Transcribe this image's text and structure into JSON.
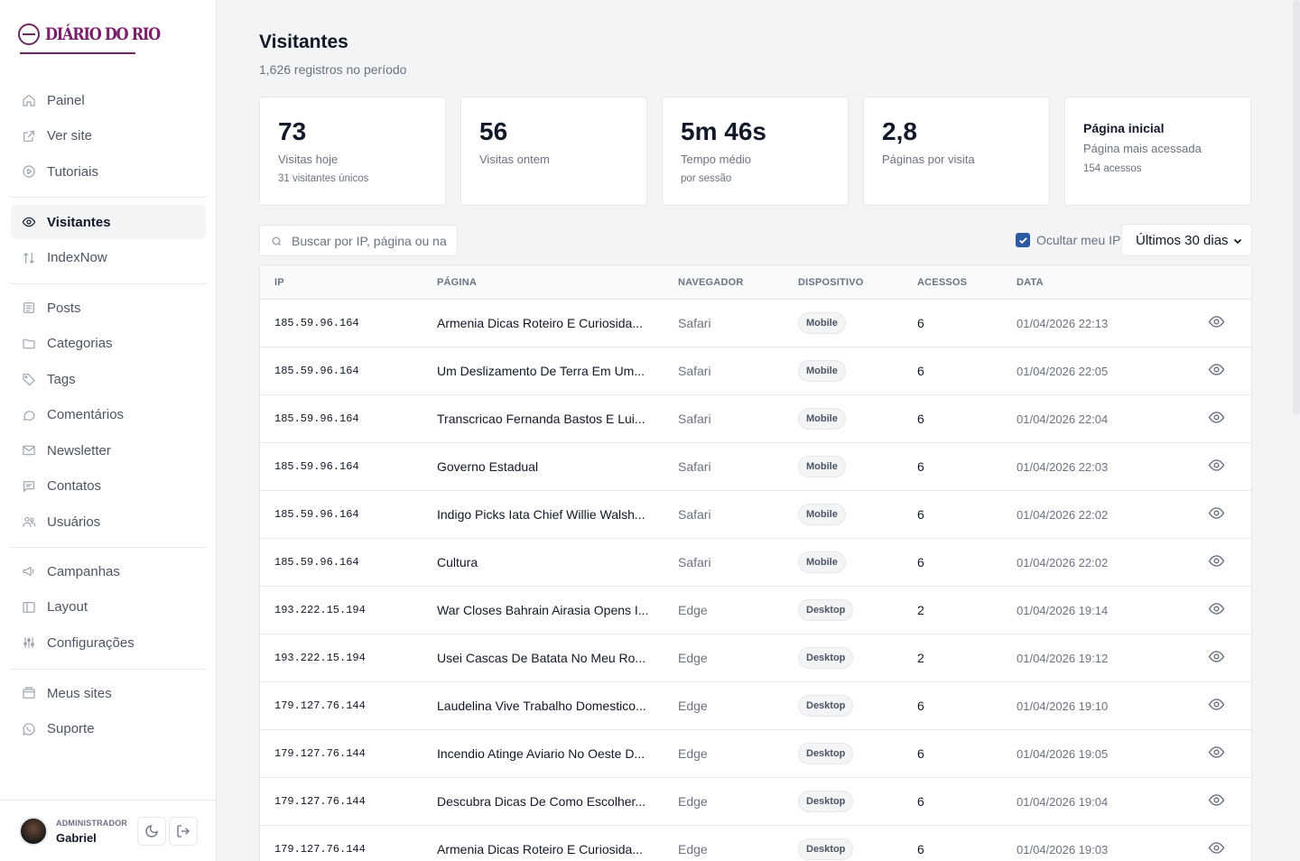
{
  "brand": {
    "name": "DIÁRIO DO RIO"
  },
  "sidebar": {
    "groups": [
      [
        {
          "label": "Painel",
          "icon": "home-icon"
        },
        {
          "label": "Ver site",
          "icon": "external-link-icon"
        },
        {
          "label": "Tutoriais",
          "icon": "play-circle-icon"
        }
      ],
      [
        {
          "label": "Visitantes",
          "icon": "eye-icon",
          "active": true
        },
        {
          "label": "IndexNow",
          "icon": "arrows-updown-icon"
        }
      ],
      [
        {
          "label": "Posts",
          "icon": "document-icon"
        },
        {
          "label": "Categorias",
          "icon": "folder-icon"
        },
        {
          "label": "Tags",
          "icon": "tag-icon"
        },
        {
          "label": "Comentários",
          "icon": "comment-icon"
        },
        {
          "label": "Newsletter",
          "icon": "mail-icon"
        },
        {
          "label": "Contatos",
          "icon": "chat-icon"
        },
        {
          "label": "Usuários",
          "icon": "users-icon"
        }
      ],
      [
        {
          "label": "Campanhas",
          "icon": "megaphone-icon"
        },
        {
          "label": "Layout",
          "icon": "layout-icon"
        },
        {
          "label": "Configurações",
          "icon": "sliders-icon"
        }
      ],
      [
        {
          "label": "Meus sites",
          "icon": "sites-icon"
        },
        {
          "label": "Suporte",
          "icon": "whatsapp-icon"
        }
      ]
    ],
    "user": {
      "role": "ADMINISTRADOR",
      "name": "Gabriel"
    }
  },
  "header": {
    "title": "Visitantes",
    "subtitle": "1,626 registros no período"
  },
  "stats": [
    {
      "value": "73",
      "label": "Visitas hoje",
      "sub": "31 visitantes únicos"
    },
    {
      "value": "56",
      "label": "Visitas ontem",
      "sub": ""
    },
    {
      "value": "5m 46s",
      "label": "Tempo médio",
      "sub": "por sessão"
    },
    {
      "value": "2,8",
      "label": "Páginas por visita",
      "sub": ""
    },
    {
      "value": "Página inicial",
      "label": "Página mais acessada",
      "sub": "154 acessos"
    }
  ],
  "filters": {
    "search_placeholder": "Buscar por IP, página ou na",
    "hide_ip_label": "Ocultar meu IP",
    "hide_ip_checked": true,
    "range_selected": "Últimos 30 dias"
  },
  "table": {
    "columns": [
      "IP",
      "PÁGINA",
      "NAVEGADOR",
      "DISPOSITIVO",
      "ACESSOS",
      "DATA"
    ],
    "rows": [
      {
        "ip": "185.59.96.164",
        "page": "Armenia Dicas Roteiro E Curiosida...",
        "browser": "Safari",
        "device": "Mobile",
        "accesses": "6",
        "date": "01/04/2026 22:13"
      },
      {
        "ip": "185.59.96.164",
        "page": "Um Deslizamento De Terra Em Um...",
        "browser": "Safari",
        "device": "Mobile",
        "accesses": "6",
        "date": "01/04/2026 22:05"
      },
      {
        "ip": "185.59.96.164",
        "page": "Transcricao Fernanda Bastos E Lui...",
        "browser": "Safari",
        "device": "Mobile",
        "accesses": "6",
        "date": "01/04/2026 22:04"
      },
      {
        "ip": "185.59.96.164",
        "page": "Governo Estadual",
        "browser": "Safari",
        "device": "Mobile",
        "accesses": "6",
        "date": "01/04/2026 22:03"
      },
      {
        "ip": "185.59.96.164",
        "page": "Indigo Picks Iata Chief Willie Walsh...",
        "browser": "Safari",
        "device": "Mobile",
        "accesses": "6",
        "date": "01/04/2026 22:02"
      },
      {
        "ip": "185.59.96.164",
        "page": "Cultura",
        "browser": "Safari",
        "device": "Mobile",
        "accesses": "6",
        "date": "01/04/2026 22:02"
      },
      {
        "ip": "193.222.15.194",
        "page": "War Closes Bahrain Airasia Opens I...",
        "browser": "Edge",
        "device": "Desktop",
        "accesses": "2",
        "date": "01/04/2026 19:14"
      },
      {
        "ip": "193.222.15.194",
        "page": "Usei Cascas De Batata No Meu Ro...",
        "browser": "Edge",
        "device": "Desktop",
        "accesses": "2",
        "date": "01/04/2026 19:12"
      },
      {
        "ip": "179.127.76.144",
        "page": "Laudelina Vive Trabalho Domestico...",
        "browser": "Edge",
        "device": "Desktop",
        "accesses": "6",
        "date": "01/04/2026 19:10"
      },
      {
        "ip": "179.127.76.144",
        "page": "Incendio Atinge Aviario No Oeste D...",
        "browser": "Edge",
        "device": "Desktop",
        "accesses": "6",
        "date": "01/04/2026 19:05"
      },
      {
        "ip": "179.127.76.144",
        "page": "Descubra Dicas De Como Escolher...",
        "browser": "Edge",
        "device": "Desktop",
        "accesses": "6",
        "date": "01/04/2026 19:04"
      },
      {
        "ip": "179.127.76.144",
        "page": "Armenia Dicas Roteiro E Curiosida...",
        "browser": "Edge",
        "device": "Desktop",
        "accesses": "6",
        "date": "01/04/2026 19:03"
      }
    ]
  }
}
